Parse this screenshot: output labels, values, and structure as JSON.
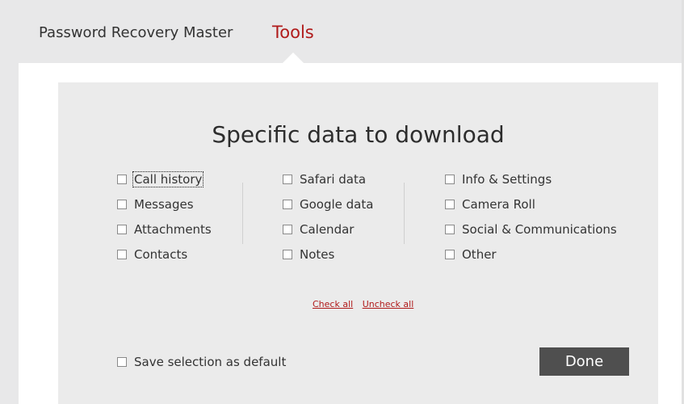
{
  "header": {
    "app_tab": "Password Recovery Master",
    "tools_tab": "Tools"
  },
  "card": {
    "title": "Specific data to download",
    "columns": [
      [
        {
          "label": "Call history",
          "checked": false,
          "focused": true
        },
        {
          "label": "Messages",
          "checked": false
        },
        {
          "label": "Attachments",
          "checked": false
        },
        {
          "label": "Contacts",
          "checked": false
        }
      ],
      [
        {
          "label": "Safari data",
          "checked": false
        },
        {
          "label": "Google data",
          "checked": false
        },
        {
          "label": "Calendar",
          "checked": false
        },
        {
          "label": "Notes",
          "checked": false
        }
      ],
      [
        {
          "label": "Info & Settings",
          "checked": false
        },
        {
          "label": "Camera Roll",
          "checked": false
        },
        {
          "label": "Social & Communications",
          "checked": false
        },
        {
          "label": "Other",
          "checked": false
        }
      ]
    ],
    "check_all": "Check all",
    "uncheck_all": "Uncheck all",
    "save_default": "Save selection as default",
    "done": "Done"
  },
  "colors": {
    "accent": "#b01a1a",
    "button_bg": "#4f4f4f",
    "panel_bg": "#ebebeb",
    "page_bg": "#e8e8e9"
  }
}
